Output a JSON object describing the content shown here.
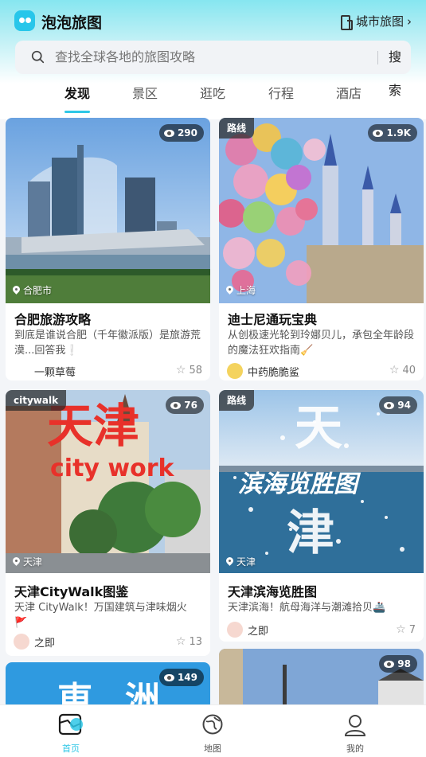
{
  "app": {
    "title": "泡泡旅图",
    "city_map": "城市旅图"
  },
  "search": {
    "placeholder": "查找全球各地的旅图攻略",
    "button": "搜索"
  },
  "tabs": [
    "发现",
    "景区",
    "逛吃",
    "行程",
    "酒店"
  ],
  "cards": [
    {
      "views": "290",
      "tag": "",
      "location": "合肥市",
      "title": "合肥旅游攻略",
      "desc": "到底是谁说合肥（千年徽派版）是旅游荒漠...回答我",
      "desc_emoji": "❕",
      "author": "一颗草莓",
      "likes": "58"
    },
    {
      "views": "1.9K",
      "tag": "路线",
      "location": "上海",
      "title": "迪士尼通玩宝典",
      "desc": "从创极速光轮到玲娜贝儿，承包全年龄段的魔法狂欢指南",
      "desc_emoji": "🧹",
      "author": "中药脆脆鲨",
      "likes": "40"
    },
    {
      "views": "76",
      "tag": "citywalk",
      "location": "天津",
      "overlay_big": "天津",
      "overlay_small": "city work",
      "title": "天津CityWalk图鉴",
      "desc": "天津 CityWalk！万国建筑与津味烟火",
      "desc_emoji": "🚩",
      "author": "之即",
      "likes": "13"
    },
    {
      "views": "94",
      "tag": "路线",
      "location": "天津",
      "overlay_top": "天",
      "overlay_mid": "滨海览胜图",
      "overlay_bot": "津",
      "title": "天津滨海览胜图",
      "desc": "天津滨海！航母海洋与潮滩拾贝",
      "desc_emoji": "🚢",
      "author": "之即",
      "likes": "7"
    },
    {
      "views": "149",
      "overlay_big": "東",
      "overlay_big2": "洲"
    },
    {
      "views": "98"
    }
  ],
  "nav": [
    {
      "label": "首页",
      "icon": "map-icon"
    },
    {
      "label": "地图",
      "icon": "globe-icon"
    },
    {
      "label": "我的",
      "icon": "user-icon"
    }
  ],
  "colors": {
    "accent": "#2fc7e6"
  }
}
